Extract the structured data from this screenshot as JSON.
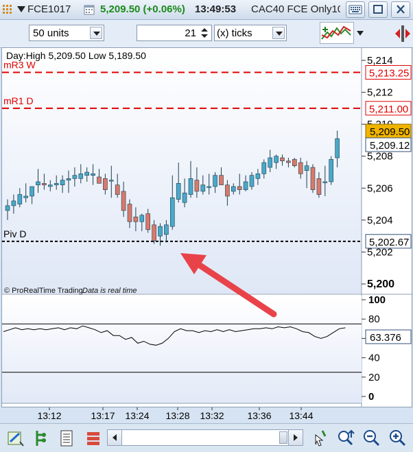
{
  "titlebar": {
    "symbol": "FCE1017",
    "price": "5,209.50 (+0.06%)",
    "time": "13:49:53",
    "instrument": "CAC40 FCE Only10"
  },
  "toolbar": {
    "units_value": "50 units",
    "ticks_value": "21",
    "ticks_mode": "(x) ticks"
  },
  "chart": {
    "info": "Day:High 5,209.50 Low 5,189.50",
    "levels": [
      {
        "label": "mR3 W",
        "value": "5,213.25",
        "color": "#e00000"
      },
      {
        "label": "mR1 D",
        "value": "5,211.00",
        "color": "#e00000"
      },
      {
        "label": "Piv D",
        "value": "5,202.67",
        "color": "#000000"
      }
    ],
    "price_tag": "5,209.50",
    "last_tag": "5,209.12",
    "yticks": [
      "5,214",
      "5,212",
      "5,210",
      "5,208",
      "5,206",
      "5,204",
      "5,202",
      "5,200"
    ],
    "copyright": "© ProRealTime Trading",
    "realtime_note": "Data is real time",
    "colors": {
      "up": "#4aa8c8",
      "down": "#d9796a",
      "level_red": "#e00000",
      "tag_bg": "#f0b400"
    }
  },
  "indicator": {
    "value_tag": "63.376",
    "yticks": [
      "100",
      "80",
      "60",
      "40",
      "20",
      "0"
    ],
    "levels": [
      75,
      25
    ]
  },
  "xaxis": {
    "ticks": [
      "13:12",
      "13:17",
      "13:24",
      "13:28",
      "13:32",
      "13:36",
      "13:44"
    ]
  },
  "chart_data": {
    "type": "candlestick",
    "ylim": [
      5200,
      5215
    ],
    "candles": [
      {
        "o": 5204.6,
        "h": 5205.3,
        "l": 5204.0,
        "c": 5204.9
      },
      {
        "o": 5204.9,
        "h": 5205.6,
        "l": 5204.4,
        "c": 5205.2
      },
      {
        "o": 5205.0,
        "h": 5206.0,
        "l": 5204.8,
        "c": 5205.6
      },
      {
        "o": 5205.4,
        "h": 5206.3,
        "l": 5205.1,
        "c": 5205.5
      },
      {
        "o": 5205.5,
        "h": 5206.1,
        "l": 5205.0,
        "c": 5206.1
      },
      {
        "o": 5206.2,
        "h": 5207.2,
        "l": 5205.7,
        "c": 5206.4
      },
      {
        "o": 5206.3,
        "h": 5206.9,
        "l": 5205.9,
        "c": 5206.2
      },
      {
        "o": 5206.1,
        "h": 5206.5,
        "l": 5205.8,
        "c": 5206.2
      },
      {
        "o": 5206.2,
        "h": 5206.8,
        "l": 5205.9,
        "c": 5206.3
      },
      {
        "o": 5206.2,
        "h": 5206.8,
        "l": 5205.7,
        "c": 5206.5
      },
      {
        "o": 5206.5,
        "h": 5207.1,
        "l": 5205.7,
        "c": 5206.6
      },
      {
        "o": 5206.6,
        "h": 5207.3,
        "l": 5206.1,
        "c": 5206.8
      },
      {
        "o": 5206.6,
        "h": 5207.5,
        "l": 5206.3,
        "c": 5206.9
      },
      {
        "o": 5206.8,
        "h": 5207.3,
        "l": 5206.4,
        "c": 5207.0
      },
      {
        "o": 5206.8,
        "h": 5207.5,
        "l": 5206.2,
        "c": 5206.9
      },
      {
        "o": 5206.7,
        "h": 5207.2,
        "l": 5206.3,
        "c": 5206.3
      },
      {
        "o": 5206.6,
        "h": 5206.9,
        "l": 5205.6,
        "c": 5205.9
      },
      {
        "o": 5206.5,
        "h": 5207.4,
        "l": 5205.4,
        "c": 5206.5
      },
      {
        "o": 5206.2,
        "h": 5206.9,
        "l": 5205.4,
        "c": 5205.6
      },
      {
        "o": 5205.8,
        "h": 5206.4,
        "l": 5204.2,
        "c": 5204.6
      },
      {
        "o": 5205.0,
        "h": 5205.3,
        "l": 5203.5,
        "c": 5203.9
      },
      {
        "o": 5204.2,
        "h": 5204.8,
        "l": 5203.3,
        "c": 5203.9
      },
      {
        "o": 5203.9,
        "h": 5204.4,
        "l": 5203.3,
        "c": 5204.3
      },
      {
        "o": 5204.4,
        "h": 5204.7,
        "l": 5203.2,
        "c": 5203.4
      },
      {
        "o": 5203.7,
        "h": 5204.0,
        "l": 5202.5,
        "c": 5202.7
      },
      {
        "o": 5203.0,
        "h": 5203.8,
        "l": 5202.4,
        "c": 5203.6
      },
      {
        "o": 5203.1,
        "h": 5204.0,
        "l": 5202.6,
        "c": 5203.7
      },
      {
        "o": 5203.6,
        "h": 5206.8,
        "l": 5203.4,
        "c": 5205.4
      },
      {
        "o": 5205.3,
        "h": 5207.6,
        "l": 5205.1,
        "c": 5206.3
      },
      {
        "o": 5205.1,
        "h": 5206.6,
        "l": 5204.8,
        "c": 5205.7
      },
      {
        "o": 5205.6,
        "h": 5207.7,
        "l": 5205.4,
        "c": 5206.6
      },
      {
        "o": 5206.5,
        "h": 5207.3,
        "l": 5205.4,
        "c": 5205.8
      },
      {
        "o": 5205.8,
        "h": 5206.8,
        "l": 5205.6,
        "c": 5206.2
      },
      {
        "o": 5206.1,
        "h": 5206.9,
        "l": 5205.6,
        "c": 5206.1
      },
      {
        "o": 5206.1,
        "h": 5207.0,
        "l": 5205.7,
        "c": 5206.8
      },
      {
        "o": 5206.8,
        "h": 5207.3,
        "l": 5206.2,
        "c": 5206.2
      },
      {
        "o": 5206.2,
        "h": 5206.5,
        "l": 5204.9,
        "c": 5205.5
      },
      {
        "o": 5205.8,
        "h": 5206.3,
        "l": 5205.6,
        "c": 5206.1
      },
      {
        "o": 5206.1,
        "h": 5206.9,
        "l": 5205.6,
        "c": 5205.9
      },
      {
        "o": 5205.9,
        "h": 5206.8,
        "l": 5205.8,
        "c": 5206.4
      },
      {
        "o": 5206.1,
        "h": 5207.0,
        "l": 5205.9,
        "c": 5206.8
      },
      {
        "o": 5206.6,
        "h": 5207.2,
        "l": 5206.2,
        "c": 5206.9
      },
      {
        "o": 5206.9,
        "h": 5207.8,
        "l": 5206.6,
        "c": 5207.6
      },
      {
        "o": 5207.3,
        "h": 5208.4,
        "l": 5207.0,
        "c": 5207.9
      },
      {
        "o": 5207.6,
        "h": 5208.1,
        "l": 5207.2,
        "c": 5208.0
      },
      {
        "o": 5207.9,
        "h": 5208.1,
        "l": 5207.4,
        "c": 5207.7
      },
      {
        "o": 5207.7,
        "h": 5207.9,
        "l": 5207.3,
        "c": 5207.6
      },
      {
        "o": 5207.8,
        "h": 5207.9,
        "l": 5207.3,
        "c": 5207.4
      },
      {
        "o": 5207.6,
        "h": 5207.9,
        "l": 5206.6,
        "c": 5206.9
      },
      {
        "o": 5207.1,
        "h": 5207.7,
        "l": 5206.0,
        "c": 5207.4
      },
      {
        "o": 5207.3,
        "h": 5207.5,
        "l": 5205.7,
        "c": 5205.9
      },
      {
        "o": 5206.6,
        "h": 5207.0,
        "l": 5205.4,
        "c": 5205.6
      },
      {
        "o": 5206.4,
        "h": 5207.4,
        "l": 5205.5,
        "c": 5206.4
      },
      {
        "o": 5206.4,
        "h": 5208.0,
        "l": 5206.2,
        "c": 5207.8
      },
      {
        "o": 5207.9,
        "h": 5209.6,
        "l": 5207.3,
        "c": 5209.1
      }
    ],
    "indicator_values": [
      67,
      69,
      71,
      69,
      70,
      69,
      70,
      69,
      70,
      71,
      69,
      71,
      70,
      73,
      71,
      69,
      66,
      68,
      63,
      63,
      59,
      61,
      55,
      57,
      54,
      53,
      55,
      60,
      67,
      70,
      68,
      68,
      66,
      68,
      67,
      69,
      67,
      69,
      67,
      68,
      69,
      70,
      70,
      71,
      70,
      72,
      71,
      72,
      70,
      67,
      66,
      62,
      60,
      62,
      66,
      70,
      71
    ]
  }
}
